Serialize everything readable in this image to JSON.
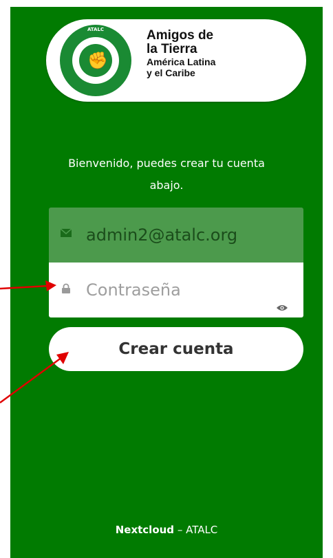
{
  "logo": {
    "emblem_text": "ATALC",
    "line1": "Amigos de",
    "line2": "la Tierra",
    "line3": "América Latina",
    "line4": "y el Caribe"
  },
  "welcome": {
    "line1": "Bienvenido, puedes crear tu cuenta",
    "line2": "abajo."
  },
  "form": {
    "username_value": "admin2@atalc.org",
    "password_placeholder": "Contraseña",
    "submit_label": "Crear cuenta"
  },
  "footer": {
    "brand": "Nextcloud",
    "separator": " – ",
    "org": "ATALC"
  },
  "colors": {
    "background_green": "#017b01",
    "field_green": "#4c9a4c",
    "annotation_arrow": "#e00000"
  },
  "icons": {
    "username": "envelope-icon",
    "password": "lock-icon",
    "toggle": "eye-icon"
  }
}
